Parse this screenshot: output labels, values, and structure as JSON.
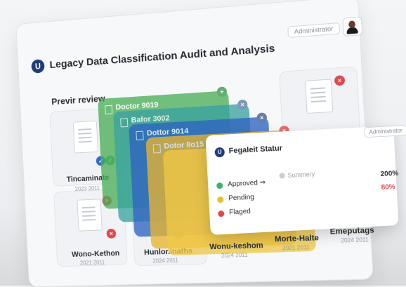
{
  "header": {
    "app_title": "Legacy Data Classification Audit and Analysis",
    "logo_letter": "U",
    "admin_label": "Administrator"
  },
  "preview": {
    "section_label": "Previr review"
  },
  "stack": [
    {
      "label": "Doctor 9019",
      "color": "#4cae5a"
    },
    {
      "label": "Bafor 3002",
      "color": "#3ba3a0"
    },
    {
      "label": "Dottor 9014",
      "color": "#2f64c2"
    },
    {
      "label": "Dotor 8o15",
      "color": "#e7b531"
    },
    {
      "label": "",
      "color": "#f0c846"
    }
  ],
  "documents": [
    {
      "name": "Tincaminate",
      "sub": "2023 2011"
    },
    {
      "name": "Wono-Kethon",
      "sub": "2021 2011"
    },
    {
      "name": "Hunlor.inaths",
      "sub": "2024 2011"
    },
    {
      "name": "Wonu-keshom",
      "sub": "2024 2011"
    },
    {
      "name": "Morte-Halte",
      "sub": "2021 2011"
    },
    {
      "name": "Emeputags",
      "sub": "2024 2011"
    }
  ],
  "status_panel": {
    "title": "Fegaleit Statur",
    "admin_label": "Administrator",
    "approved": "Approved ⇒",
    "pending": "Pending",
    "flagged": "Flaged",
    "summary": "Summery",
    "pct_approved": "200%",
    "pct_flagged": "80%",
    "colors": {
      "approved": "#3bb36a",
      "pending": "#e8c12e",
      "flagged": "#e0484c"
    }
  }
}
